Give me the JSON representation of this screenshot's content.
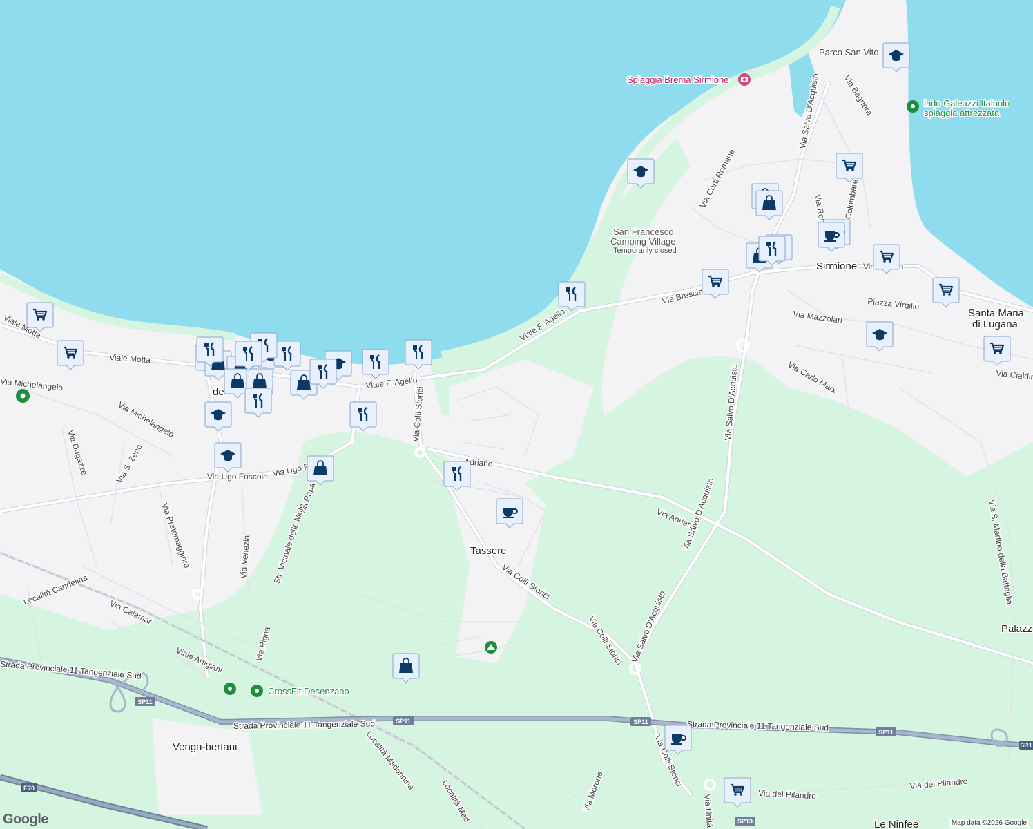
{
  "colors": {
    "water": "#8fdcef",
    "land": "#f3f3f5",
    "green": "#d6f5e0",
    "highway": "#8e9fb9",
    "marker_fill": "#e8f0fe",
    "marker_icon": "#0b3a66",
    "poi_green": "#1e8e3e",
    "poi_pink": "#c2185b"
  },
  "places": {
    "sirmione": "Sirmione",
    "santa_maria_1": "Santa Maria",
    "santa_maria_2": "di Lugana",
    "tassere": "Tassere",
    "venga_bertani": "Venga-bertani",
    "le_ninfee": "Le Ninfee",
    "palazz": "Palazz",
    "parco_san_vito": "Parco San Vito",
    "dez_fragment": "de"
  },
  "pois": {
    "spiaggia_brema": "Spiaggia Brema Sirmione",
    "lido_1": "Lido Galeazzi Italnolo",
    "lido_2": "spiaggia attrezzata",
    "camping_1": "San Francesco",
    "camping_2": "Camping Village",
    "camping_3": "Temporarily closed",
    "crossfit": "CrossFit Desenzano"
  },
  "streets": {
    "viale_motta_a": "Viale Motta",
    "viale_motta_b": "Viale Motta",
    "via_michelangelo_a": "Via Michelangelo",
    "via_michelangelo_b": "Via Michelangelo",
    "via_dugazze": "Via Dugazze",
    "via_s_zeno": "Via S. Zeno",
    "via_ugo_foscolo_a": "Via Ugo Foscolo",
    "via_ugo_foscolo_b": "Via Ugo Fo",
    "via_papa": "Via Papa",
    "via_pratomaggiore": "Via Pratomaggiore",
    "via_venezia": "Via Venezia",
    "str_vicinale": "Str. Vicinale delle Mole",
    "localita_candelina": "Località Candelina",
    "via_calamar": "Via Calamar",
    "viale_artigiani": "Viale Artigiani",
    "via_pigna": "Via Pigna",
    "viale_agello_a": "Viale F. Agello",
    "viale_agello_b": "Viale F. Agello",
    "via_colli_storici_a": "Via Colli Storici",
    "via_colli_storici_b": "Via Colli Storici",
    "via_colli_storici_c": "Via Colli Storici",
    "via_colli_storici_d": "Via Colli Storici",
    "via_adriano_a": "Adriano",
    "via_adriano_b": "Via Adriano",
    "via_salvo_a": "Via Salvo D'Acquisto",
    "via_salvo_b": "Via Salvo D'Acquisto",
    "via_salvo_c": "Via Salvo D'Acquisto",
    "via_salvo_d": "Via Salvo D'Acquisto",
    "via_brescia": "Via Brescia",
    "via_verona": "Via Verona",
    "piazza_virgilio": "Piazza Virgilio",
    "via_mazzolari": "Via Mazzolari",
    "via_carlo_marx": "Via Carlo Marx",
    "via_cialdini": "Via Cialdini",
    "via_corti_romane": "Via Corti Romane",
    "via_bagnera": "Via Bagnera",
    "via_romana": "Via Romana",
    "via_colombare": "Colombare",
    "via_s_martino": "Via S. Martino della Battaglia",
    "localita_madonnina": "Località Madonnina",
    "localita_mad": "Località Mad",
    "via_morone": "Via Morone",
    "via_pilandro_a": "Via del Pilandro",
    "via_pilandro_b": "Via del Pilandro",
    "via_unita": "Via Unità d'Italia"
  },
  "highways": {
    "sp11_a": "Strada Provinciale 11 Tangenziale Sud",
    "sp11_b": "Strada Provinciale 11 Tangenziale Sud",
    "sp11_c": "Strada Provinciale 11 Tangenziale Sud",
    "shield_sp11": "SP11",
    "shield_sp13": "SP13",
    "shield_e70": "E70",
    "shield_sr11": "SR1"
  },
  "attribution": "Map data ©2026 Google",
  "logo": "Google"
}
